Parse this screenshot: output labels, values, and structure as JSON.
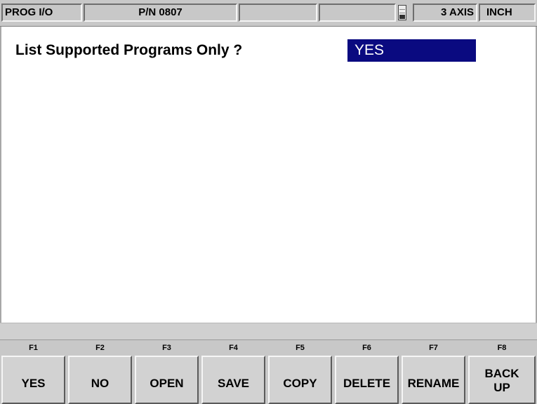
{
  "status_bar": {
    "mode": "PROG I/O",
    "part_number": "P/N 0807",
    "field_3": "",
    "field_4": "",
    "axis": "3 AXIS",
    "units": "INCH",
    "gauge_icon": "level-gauge-icon",
    "gauge_level": 0.35
  },
  "main": {
    "prompt": "List Supported Programs Only ?",
    "value": "YES"
  },
  "message": "",
  "softkeys": [
    {
      "fkey": "F1",
      "label": "YES"
    },
    {
      "fkey": "F2",
      "label": "NO"
    },
    {
      "fkey": "F3",
      "label": "OPEN"
    },
    {
      "fkey": "F4",
      "label": "SAVE"
    },
    {
      "fkey": "F5",
      "label": "COPY"
    },
    {
      "fkey": "F6",
      "label": "DELETE"
    },
    {
      "fkey": "F7",
      "label": "RENAME"
    },
    {
      "fkey": "F8",
      "label": "BACK UP"
    }
  ],
  "colors": {
    "selection_bg": "#0a0a80",
    "selection_text": "#ffffff",
    "panel": "#c8c8c8"
  }
}
